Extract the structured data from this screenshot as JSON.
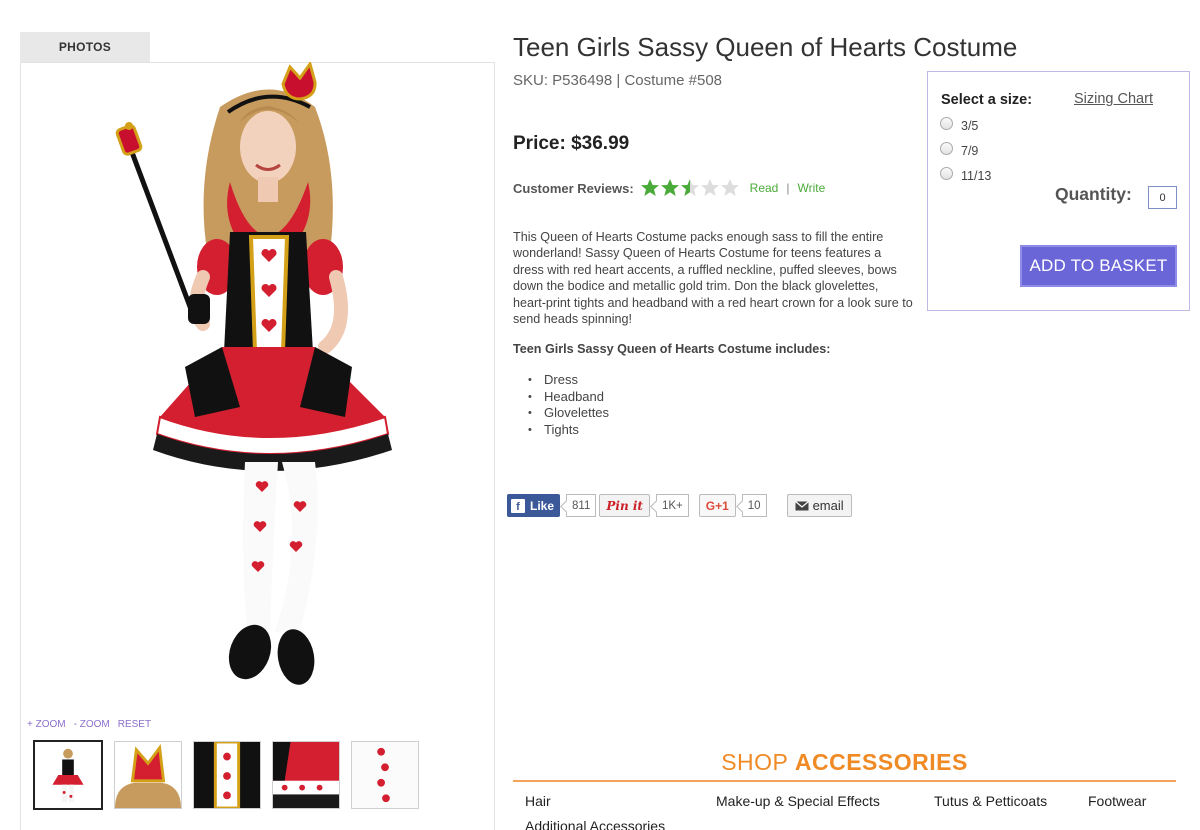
{
  "gallery": {
    "tab_label": "PHOTOS",
    "zoom_in": "+ ZOOM",
    "zoom_out": "- ZOOM",
    "reset": "RESET",
    "thumbnail_count": 5
  },
  "product": {
    "title": "Teen Girls Sassy Queen of Hearts Costume",
    "sku_line": "SKU: P536498  |  Costume #508",
    "price": "Price: $36.99",
    "reviews": {
      "label": "Customer Reviews:",
      "rating": 2.5,
      "max_rating": 5,
      "read": "Read",
      "separator": "|",
      "write": "Write"
    },
    "description": "This Queen of Hearts Costume packs enough sass to fill the entire wonderland! Sassy Queen of Hearts Costume for teens features a dress with red heart accents, a ruffled neckline, puffed sleeves, bows down the bodice and metallic gold trim. Don the black glovelettes, heart-print tights and headband with a red heart crown for a look sure to send heads spinning!",
    "includes_title": "Teen Girls Sassy Queen of Hearts Costume includes:",
    "includes": [
      "Dress",
      "Headband",
      "Glovelettes",
      "Tights"
    ]
  },
  "social": {
    "facebook_label": "Like",
    "facebook_count": "811",
    "pinterest_label": "Pin it",
    "pinterest_count": "1K+",
    "gplus_label": "G+1",
    "gplus_count": "10",
    "email_label": "email"
  },
  "purchase": {
    "select_size_label": "Select a size:",
    "sizing_chart": "Sizing Chart",
    "sizes": [
      "3/5",
      "7/9",
      "11/13"
    ],
    "quantity_label": "Quantity:",
    "quantity_value": "0",
    "add_button": "ADD TO BASKET"
  },
  "shop_accessories": {
    "title_prefix": "SHOP ",
    "title_bold": "ACCESSORIES",
    "categories": [
      "Hair",
      "Make-up & Special Effects",
      "Tutus & Petticoats",
      "Footwear",
      "Additional Accessories"
    ]
  },
  "colors": {
    "accent_purple": "#6b66d8",
    "review_green": "#4aaa3a",
    "shop_orange": "#f08a24",
    "price_text": "#222222"
  }
}
